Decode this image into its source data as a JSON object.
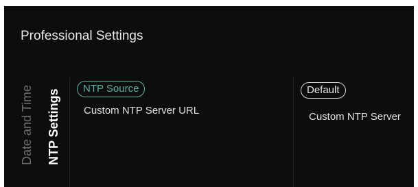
{
  "header": {
    "title": "Professional Settings"
  },
  "sidebar": {
    "tabs": [
      {
        "label": "Date and Time",
        "selected": false
      },
      {
        "label": "NTP Settings",
        "selected": true
      }
    ]
  },
  "middle_column": {
    "selected_item": "NTP Source",
    "items": [
      "Custom NTP Server URL"
    ]
  },
  "right_column": {
    "selected_item": "Default",
    "items": [
      "Custom NTP Server"
    ]
  },
  "colors": {
    "background": "#0d0d0d",
    "accent": "#5fb3a6",
    "text": "#e2e2e2",
    "inactive_text": "#6f6f6f"
  }
}
